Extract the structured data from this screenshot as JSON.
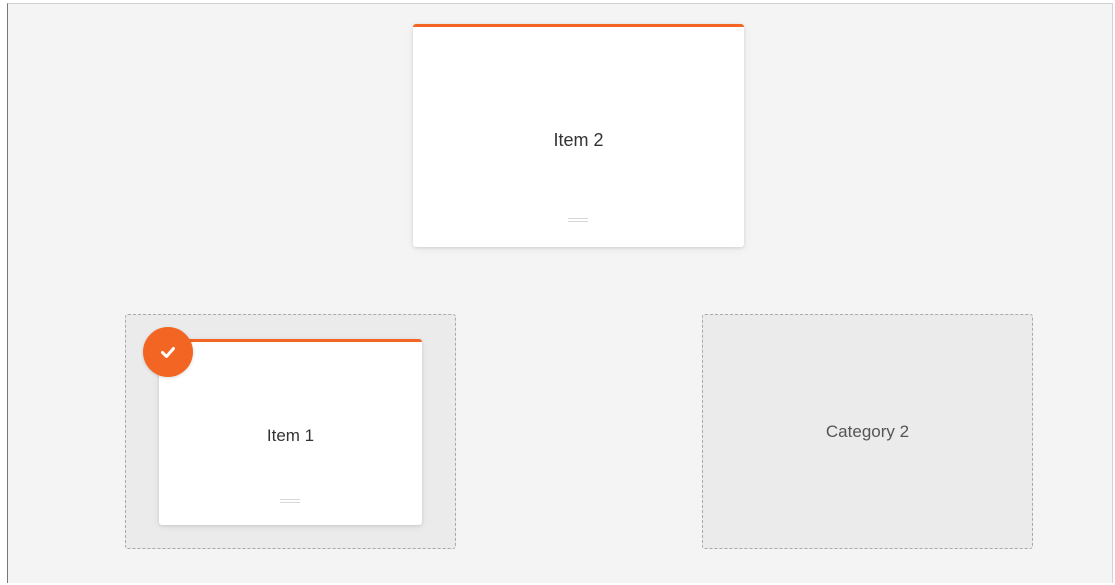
{
  "items": {
    "item_2": {
      "label": "Item 2"
    },
    "item_1": {
      "label": "Item 1",
      "selected": true
    }
  },
  "categories": {
    "category_2": {
      "label": "Category 2"
    }
  },
  "colors": {
    "accent": "#f26522",
    "background": "#f4f4f4",
    "drop_zone": "#ebebeb",
    "card": "#ffffff"
  },
  "icons": {
    "selected_badge": "check-icon",
    "card_handle": "drag-handle-icon"
  }
}
